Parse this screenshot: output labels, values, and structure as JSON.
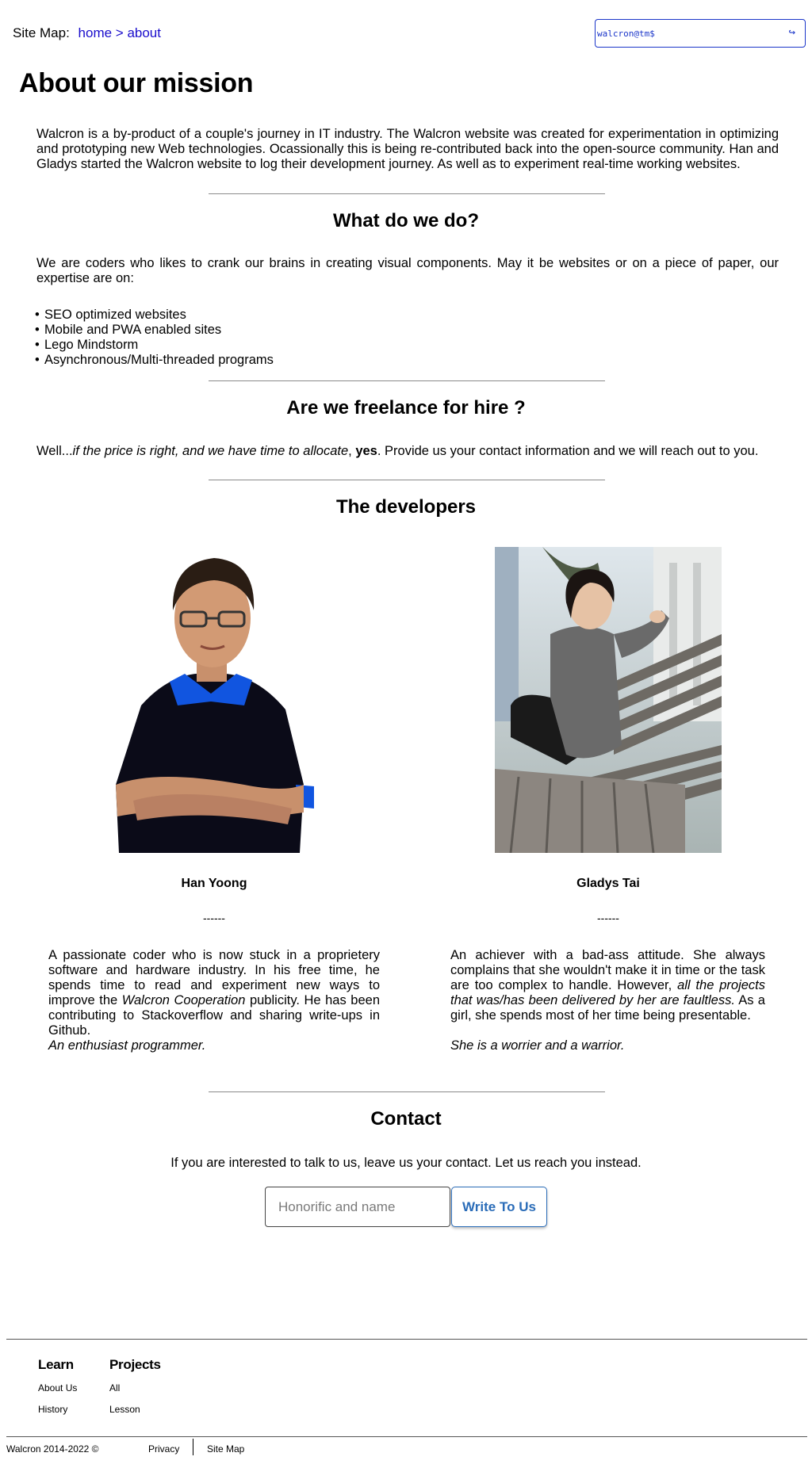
{
  "header": {
    "sitemap_label": "Site Map:",
    "breadcrumb": "home > about",
    "terminal_prompt": "walcron@tm$",
    "terminal_enter_icon": "↪"
  },
  "page": {
    "title": "About our mission",
    "intro": "Walcron is a by-product of a couple's journey in IT industry. The Walcron website was created for experimentation in optimizing and prototyping new Web technologies. Ocassionally this is being re-contributed back into the open-source community. Han and Gladys started the Walcron website to log their development journey. As well as to experiment real-time working websites."
  },
  "what_we_do": {
    "heading": "What do we do?",
    "text": "We are coders who likes to crank our brains in creating visual components. May it be websites or on a piece of paper, our expertise are on:",
    "skills": [
      "SEO optimized websites",
      "Mobile and PWA enabled sites",
      "Lego Mindstorm",
      "Asynchronous/Multi-threaded programs"
    ]
  },
  "freelance": {
    "heading": "Are we freelance for hire ?",
    "prefix": "Well...",
    "italic": "if the price is right, and we have time to allocate",
    "comma": ", ",
    "bold": "yes",
    "suffix": ". Provide us your contact information and we will reach out to you."
  },
  "developers": {
    "heading": "The developers",
    "people": [
      {
        "name": "Han Yoong",
        "dash": "------",
        "bio_1": "A passionate coder who is now stuck in a proprietery software and hardware industry. In his free time, he spends time to read and experiment new ways to improve the ",
        "bio_italic": "Walcron Cooperation",
        "bio_2": " publicity. He has been contributing to Stackoverflow and sharing write-ups in Github.",
        "quote": "An enthusiast programmer."
      },
      {
        "name": "Gladys Tai",
        "dash": "------",
        "bio_1": "An achiever with a bad-ass attitude. She always complains that she wouldn't make it in time or the task are too complex to handle. However, ",
        "bio_italic": "all the projects that was/has been delivered by her are faultless.",
        "bio_2": " As a girl, she spends most of her time being presentable.",
        "quote": "She is a worrier and a warrior."
      }
    ]
  },
  "contact": {
    "heading": "Contact",
    "text": "If you are interested to talk to us, leave us your contact. Let us reach you instead.",
    "input_placeholder": "Honorific and name",
    "button_label": "Write To Us"
  },
  "footer": {
    "columns": [
      {
        "title": "Learn",
        "links": [
          "About Us",
          "History"
        ]
      },
      {
        "title": "Projects",
        "links": [
          "All",
          "Lesson"
        ]
      }
    ],
    "copyright": "Walcron 2014-2022 ©",
    "bottom_links": [
      "Privacy",
      "Site Map"
    ]
  },
  "colors": {
    "link": "#1a0dcc",
    "terminal": "#1a35c9",
    "button": "#2a6cb8"
  }
}
